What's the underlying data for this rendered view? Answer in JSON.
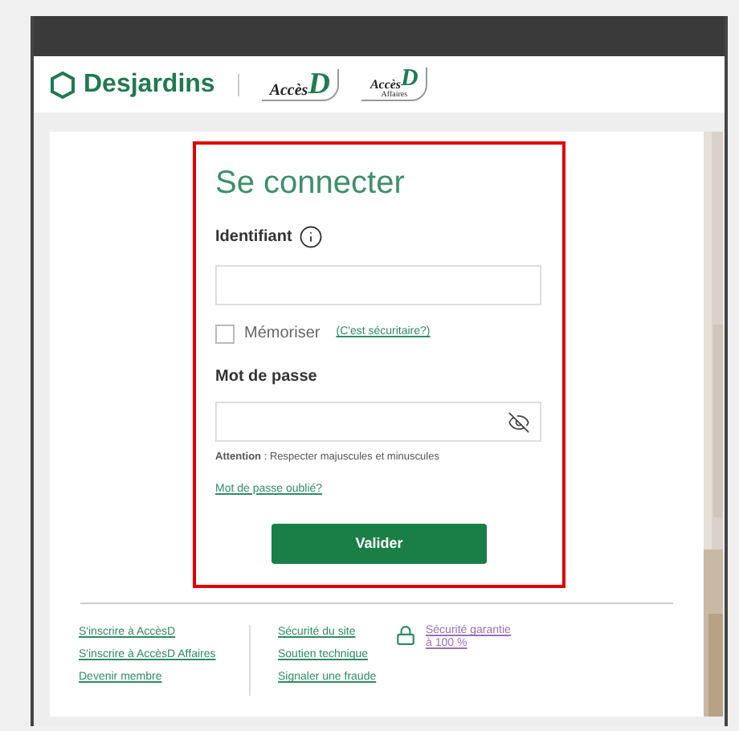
{
  "header": {
    "logo": "Desjardins",
    "brands": [
      {
        "word": "Accès",
        "letter": "D"
      },
      {
        "word": "Accès",
        "letter": "D",
        "sub": "Affaires"
      }
    ]
  },
  "login": {
    "title": "Se connecter",
    "id_label": "Identifiant",
    "remember": {
      "label": "Mémoriser",
      "checked": false
    },
    "remember_link": "(C'est sécuritaire?)",
    "password_label": "Mot de passe",
    "attention": "**Attention** : Respecter majuscules et minuscules",
    "forgot_link": "Mot de passe oublié?",
    "submit": "Valider"
  },
  "footer": {
    "columns": [
      [
        "S'inscrire à AccèsD",
        "S'inscrire à AccèsD Affaires",
        "Devenir membre"
      ],
      [
        "Sécurité du site",
        "Soutien technique",
        "Signaler une fraude"
      ]
    ],
    "guarantee": [
      "Sécurité garantie",
      "à 100 %"
    ]
  }
}
